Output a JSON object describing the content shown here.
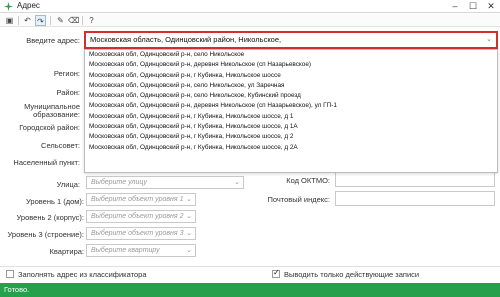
{
  "window": {
    "title": "Адрес"
  },
  "toolbar": {
    "buttons": [
      {
        "name": "save-icon",
        "glyph": "▣"
      },
      {
        "name": "undo-icon",
        "glyph": "↶"
      },
      {
        "name": "redo-icon",
        "glyph": "↷"
      },
      {
        "name": "wand-icon",
        "glyph": "✎"
      },
      {
        "name": "delete-icon",
        "glyph": "🗑"
      },
      {
        "name": "help-icon",
        "glyph": "?"
      }
    ]
  },
  "form": {
    "address_label": "Введите адрес:",
    "address_value": "Московская область, Одинцовский район, Никольское,",
    "region_label": "Регион:",
    "district_label": "Район:",
    "municipal_label_1": "Муниципальное",
    "municipal_label_2": "образование:",
    "city_district_label": "Городской район:",
    "rural_label": "Сельсовет:",
    "settlement_label": "Населенный пункт:",
    "street_label": "Улица:",
    "street_placeholder": "Выберите улицу",
    "level1_label": "Уровень 1 (дом):",
    "level1_placeholder": "Выберите объект уровня 1",
    "level2_label": "Уровень 2 (корпус):",
    "level2_placeholder": "Выберите объект уровня 2",
    "level3_label": "Уровень 3 (строение):",
    "level3_placeholder": "Выберите объект уровня 3",
    "apartment_label": "Квартира:",
    "apartment_placeholder": "Выберите квартиру",
    "oktmo_label": "Код ОКТМО:",
    "postal_label": "Почтовый индекс:"
  },
  "suggestions": [
    "Московская обл, Одинцовский р-н, село Никольское",
    "Московская обл, Одинцовский р-н, деревня Никольское (сп Назарьевское)",
    "Московская обл, Одинцовский р-н, г Кубинка, Никольское шоссе",
    "Московская обл, Одинцовский р-н, село Никольское, ул Заречная",
    "Московская обл, Одинцовский р-н, село Никольское, Кубинский проезд",
    "Московская обл, Одинцовский р-н, деревня Никольское (сп Назарьевское), ул ГП-1",
    "Московская обл, Одинцовский р-н, г Кубинка, Никольское шоссе, д 1",
    "Московская обл, Одинцовский р-н, г Кубинка, Никольское шоссе, д 1А",
    "Московская обл, Одинцовский р-н, г Кубинка, Никольское шоссе, д 2",
    "Московская обл, Одинцовский р-н, г Кубинка, Никольское шоссе, д 2А"
  ],
  "footer": {
    "fill_from_classifier": "Заполнять адрес из классификатора",
    "fill_from_classifier_checked": false,
    "show_active_only": "Выводить только действующие записи",
    "show_active_only_checked": true
  },
  "status": {
    "text": "Готово."
  },
  "colors": {
    "status_bar": "#26a04a",
    "focus_border": "#d32f2f"
  }
}
